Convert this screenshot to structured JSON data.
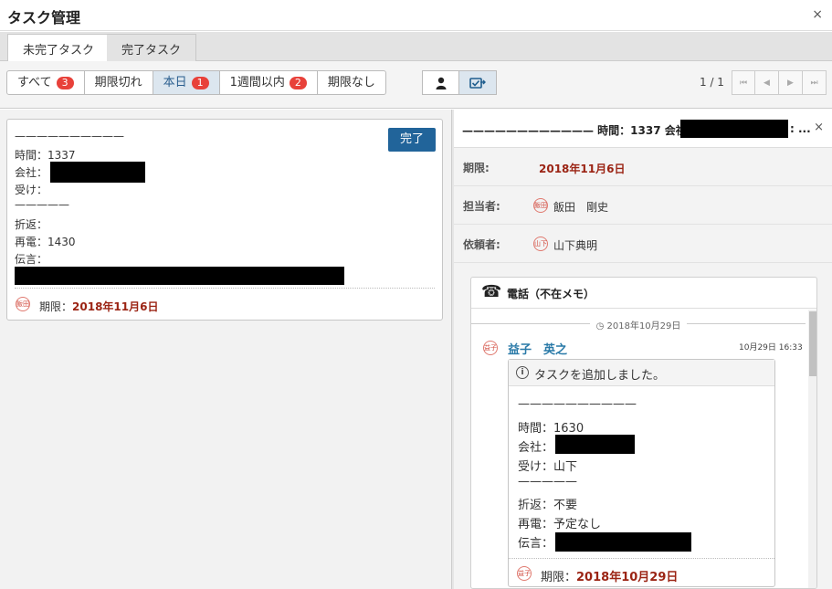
{
  "window": {
    "title": "タスク管理",
    "close": "×"
  },
  "tabs": [
    {
      "label": "未完了タスク",
      "active": true
    },
    {
      "label": "完了タスク",
      "active": false
    }
  ],
  "filters": [
    {
      "label": "すべて",
      "count": "3"
    },
    {
      "label": "期限切れ",
      "count": ""
    },
    {
      "label": "本日",
      "count": "1"
    },
    {
      "label": "1週間以内",
      "count": "2"
    },
    {
      "label": "期限なし",
      "count": ""
    }
  ],
  "view_buttons": [
    {
      "icon": "person-icon"
    },
    {
      "icon": "task-assign-icon"
    }
  ],
  "pager": {
    "text": "1 / 1",
    "first": "⏮",
    "prev": "◀",
    "next": "▶",
    "last": "⏭"
  },
  "task_card": {
    "separator": "——————————",
    "time": "時間：1337",
    "company": "会社：",
    "receiver": "受け：",
    "separator2": "—————",
    "callback": "折返：",
    "recall": "再電：1430",
    "message": "伝言：",
    "done_button": "完了",
    "stamp": "飯田",
    "due_label": "期限：",
    "due_value": "2018年11月6日"
  },
  "detail": {
    "header": "———————————— 時間：1337 会社",
    "header_tail": ": ...",
    "close": "×",
    "due": {
      "label": "期限:",
      "value": "2018年11月6日"
    },
    "assignee": {
      "label": "担当者:",
      "stamp": "飯田",
      "name": "飯田　剛史"
    },
    "requester": {
      "label": "依頼者:",
      "stamp": "山下",
      "name": "山下典明"
    },
    "memo": {
      "title": "電話（不在メモ）",
      "date_separator": "2018年10月29日",
      "author": "益子　英之",
      "author_stamp": "益子",
      "timestamp": "10月29日 16:33",
      "action_text": "タスクを追加しました。",
      "separator": "——————————",
      "time": "時間：1630",
      "company": "会社：",
      "receiver": "受け：山下",
      "separator2": "—————",
      "callback": "折返：不要",
      "recall": "再電：予定なし",
      "message": "伝言：",
      "stamp": "益子",
      "due_label": "期限：",
      "due_value": "2018年10月29日"
    }
  },
  "colors": {
    "accent": "#21649a",
    "badge": "#e8413a",
    "due": "#9b2414",
    "author": "#2a7aa8"
  }
}
